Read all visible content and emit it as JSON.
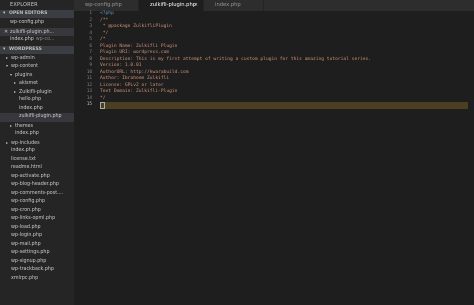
{
  "explorer": {
    "title": "EXPLORER"
  },
  "open_editors": {
    "label": "OPEN EDITORS",
    "items": [
      {
        "name": "wp-config.php",
        "close": "",
        "path": ""
      },
      {
        "name": "zulkifli-plugin.ph...",
        "close": "✕",
        "path": ""
      },
      {
        "name": "index.php",
        "close": "",
        "path": "wp-co..."
      }
    ]
  },
  "folder": {
    "label": "WORDPRESS",
    "items": [
      {
        "name": "wp-admin",
        "chev": "▸",
        "indent": 1
      },
      {
        "name": "wp-content",
        "chev": "▾",
        "indent": 1
      },
      {
        "name": "plugins",
        "chev": "▾",
        "indent": 2
      },
      {
        "name": "akismet",
        "chev": "▸",
        "indent": 3
      },
      {
        "name": "Zulkifli-plugin",
        "chev": "▸",
        "indent": 3
      },
      {
        "name": "hello.php",
        "chev": "",
        "indent": 3
      },
      {
        "name": "index.php",
        "chev": "",
        "indent": 3
      },
      {
        "name": "zulkifli-plugin.php",
        "chev": "",
        "indent": 3,
        "active": true
      },
      {
        "name": "themes",
        "chev": "▸",
        "indent": 2
      },
      {
        "name": "index.php",
        "chev": "",
        "indent": 2
      },
      {
        "name": "wp-includes",
        "chev": "▸",
        "indent": 1
      },
      {
        "name": "index.php",
        "chev": "",
        "indent": 1
      },
      {
        "name": "license.txt",
        "chev": "",
        "indent": 1
      },
      {
        "name": "readme.html",
        "chev": "",
        "indent": 1
      },
      {
        "name": "wp-activate.php",
        "chev": "",
        "indent": 1
      },
      {
        "name": "wp-blog-header.php",
        "chev": "",
        "indent": 1
      },
      {
        "name": "wp-comments-post....",
        "chev": "",
        "indent": 1
      },
      {
        "name": "wp-config.php",
        "chev": "",
        "indent": 1
      },
      {
        "name": "wp-cron.php",
        "chev": "",
        "indent": 1
      },
      {
        "name": "wp-links-opml.php",
        "chev": "",
        "indent": 1
      },
      {
        "name": "wp-load.php",
        "chev": "",
        "indent": 1
      },
      {
        "name": "wp-login.php",
        "chev": "",
        "indent": 1
      },
      {
        "name": "wp-mail.php",
        "chev": "",
        "indent": 1
      },
      {
        "name": "wp-settings.php",
        "chev": "",
        "indent": 1
      },
      {
        "name": "wp-signup.php",
        "chev": "",
        "indent": 1
      },
      {
        "name": "wp-trackback.php",
        "chev": "",
        "indent": 1
      },
      {
        "name": "xmlrpc.php",
        "chev": "",
        "indent": 1
      }
    ]
  },
  "tabs": [
    {
      "label": "wp-config.php",
      "active": false,
      "close": ""
    },
    {
      "label": "zulkifli-plugin.php",
      "active": true,
      "close": "✕"
    },
    {
      "label": "index.php",
      "active": false,
      "close": ""
    }
  ],
  "editor": {
    "current_line": 15,
    "lines": [
      {
        "n": "1",
        "text": "<?php",
        "kind": "kw"
      },
      {
        "n": "2",
        "text": "/**",
        "kind": "cm"
      },
      {
        "n": "3",
        "text": " * @package ZulkifliPlugin",
        "kind": "cm"
      },
      {
        "n": "4",
        "text": " */",
        "kind": "cm"
      },
      {
        "n": "5",
        "text": "/*",
        "kind": "cm"
      },
      {
        "n": "6",
        "text": "Plugin Name: Zulkifli Plugin",
        "kind": "cm"
      },
      {
        "n": "7",
        "text": "Plugin URI: wordpress.com",
        "kind": "cm"
      },
      {
        "n": "8",
        "text": "Description: This is my first attempt of writing a custom plugin for this amazing tutorial series.",
        "kind": "cm"
      },
      {
        "n": "9",
        "text": "Version: 1.0.01",
        "kind": "cm"
      },
      {
        "n": "10",
        "text": "AuthorURL: http://kwarabuild.com",
        "kind": "cm"
      },
      {
        "n": "11",
        "text": "Author: Ibraheem Zulkifli",
        "kind": "cm"
      },
      {
        "n": "12",
        "text": "License: GPLv2 or later",
        "kind": "cm"
      },
      {
        "n": "13",
        "text": "Text Domain: Zulkifli-Plugin",
        "kind": "cm"
      },
      {
        "n": "14",
        "text": "*/",
        "kind": "cm"
      },
      {
        "n": "15",
        "text": "",
        "kind": "cursor"
      }
    ]
  }
}
